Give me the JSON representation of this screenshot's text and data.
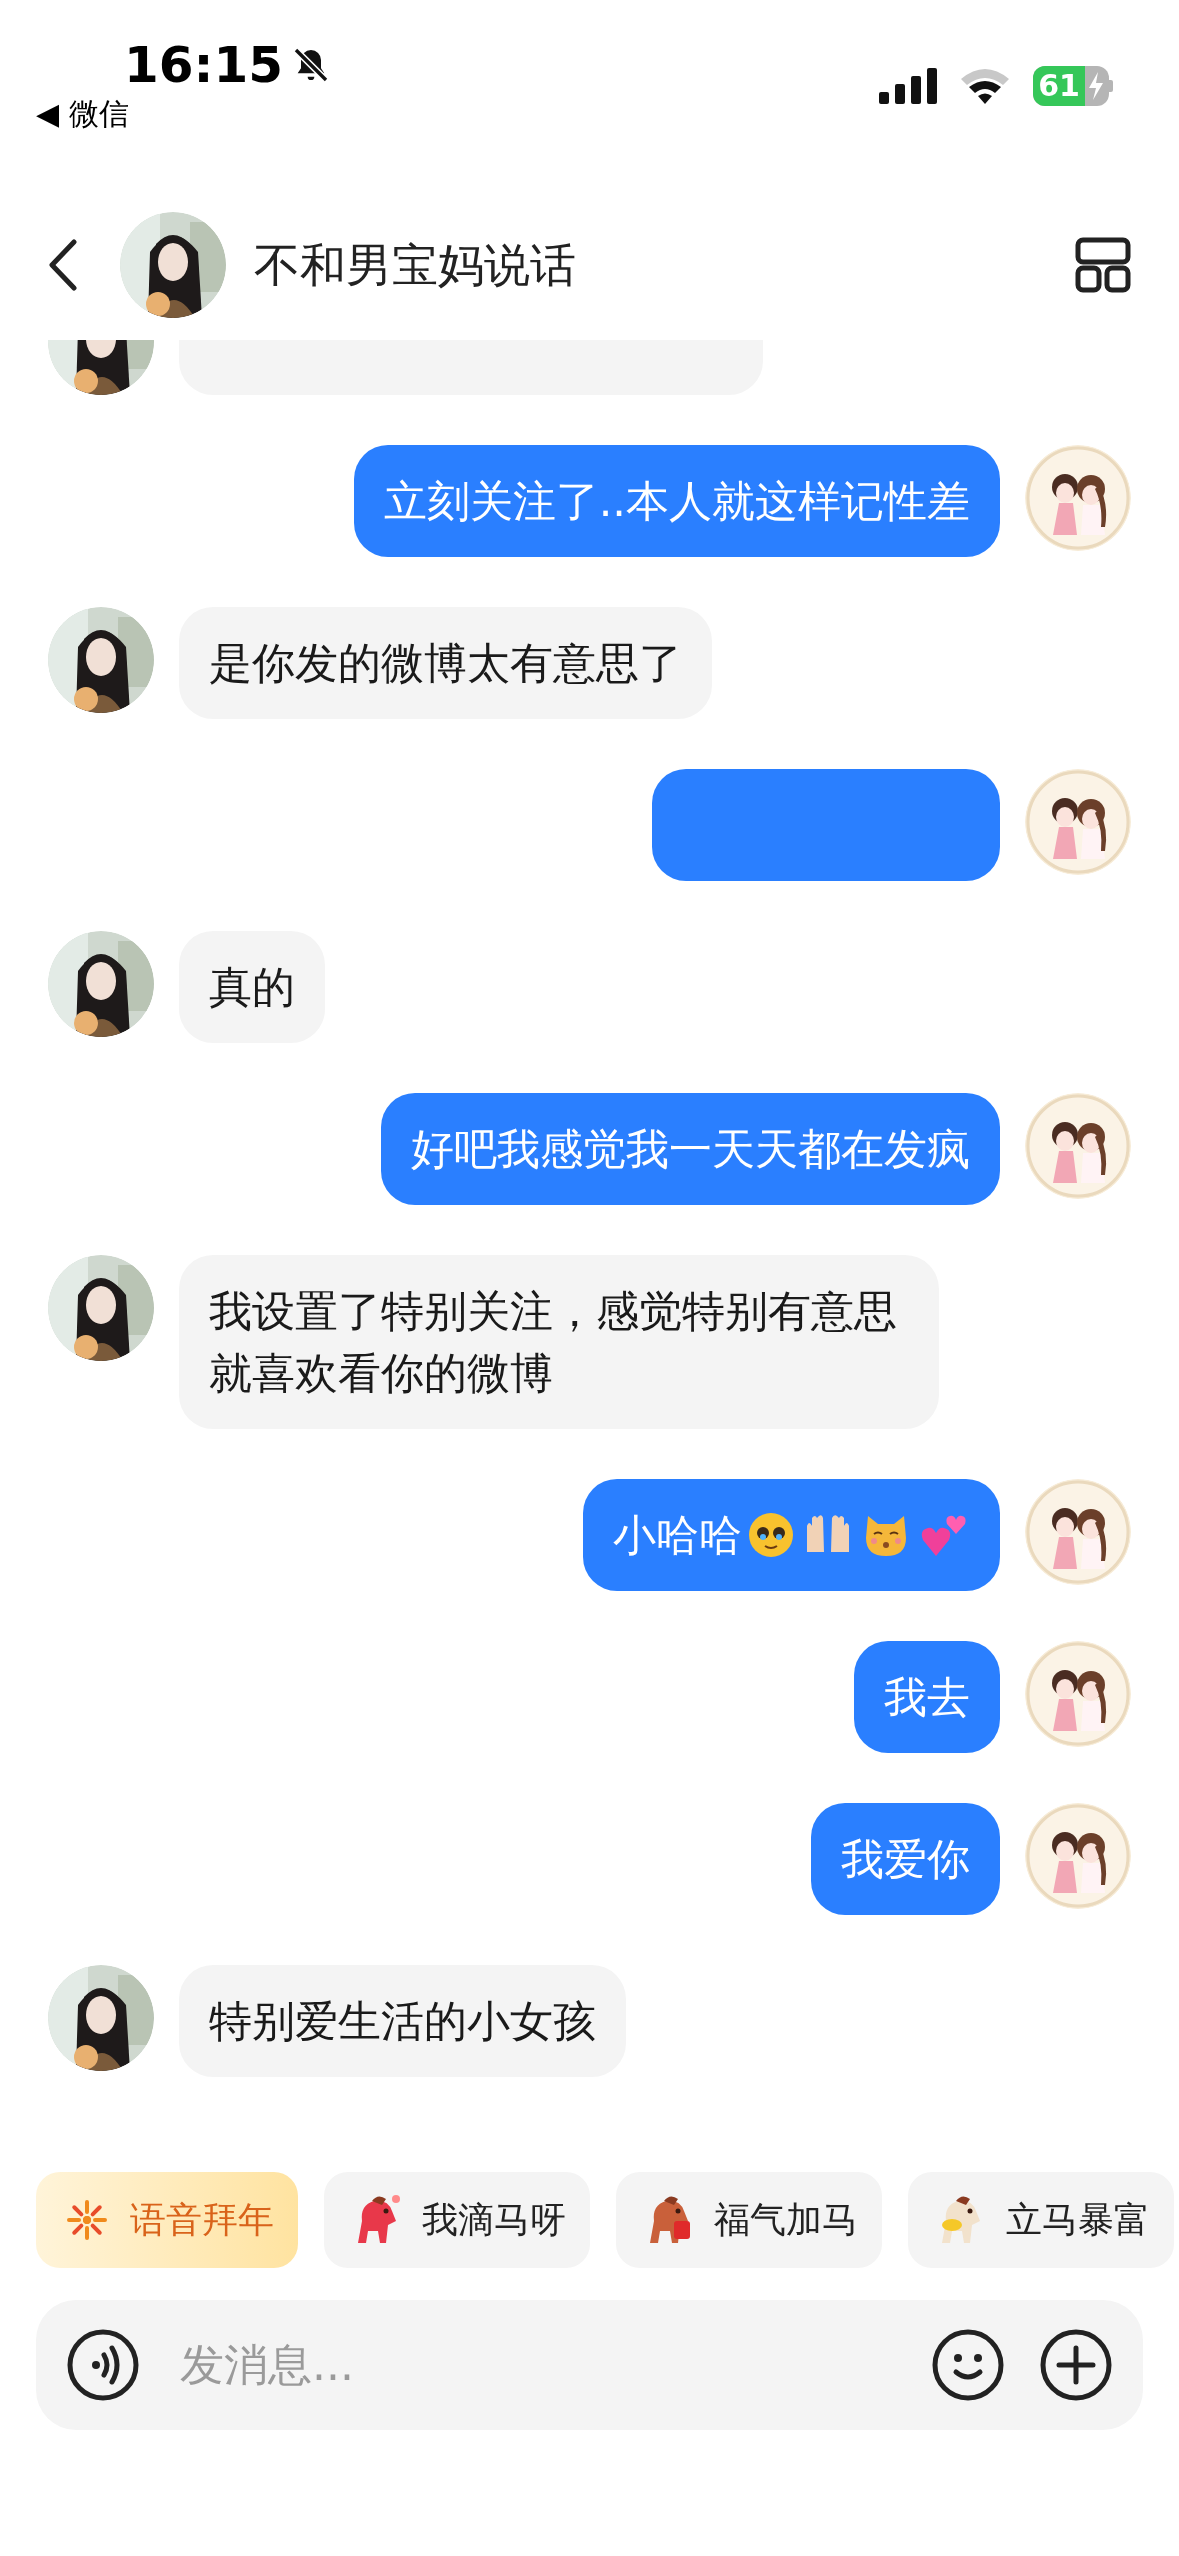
{
  "status_bar": {
    "time": "16:15",
    "back_app": "◀ 微信",
    "battery": "61"
  },
  "header": {
    "title": "不和男宝妈说话"
  },
  "messages": [
    {
      "outgoing": false,
      "kind": "cut"
    },
    {
      "outgoing": true,
      "kind": "text",
      "text": "立刻关注了..本人就这样记性差"
    },
    {
      "outgoing": false,
      "kind": "text",
      "text": "是你发的微博太有意思了"
    },
    {
      "outgoing": true,
      "kind": "blurred"
    },
    {
      "outgoing": false,
      "kind": "text",
      "text": "真的"
    },
    {
      "outgoing": true,
      "kind": "text",
      "text": "好吧我感觉我一天天都在发疯"
    },
    {
      "outgoing": false,
      "kind": "text",
      "text": "我设置了特别关注，感觉特别有意思就喜欢看你的微博"
    },
    {
      "outgoing": true,
      "kind": "emoji",
      "text": "小哈哈"
    },
    {
      "outgoing": true,
      "kind": "text",
      "text": "我去"
    },
    {
      "outgoing": true,
      "kind": "text",
      "text": "我爱你"
    },
    {
      "outgoing": false,
      "kind": "text",
      "text": "特别爱生活的小女孩"
    }
  ],
  "chips": [
    {
      "kind": "voice",
      "label": "语音拜年"
    },
    {
      "kind": "sticker",
      "label": "我滴马呀"
    },
    {
      "kind": "sticker",
      "label": "福气加马"
    },
    {
      "kind": "sticker",
      "label": "立马暴富"
    }
  ],
  "input": {
    "placeholder": "发消息..."
  }
}
